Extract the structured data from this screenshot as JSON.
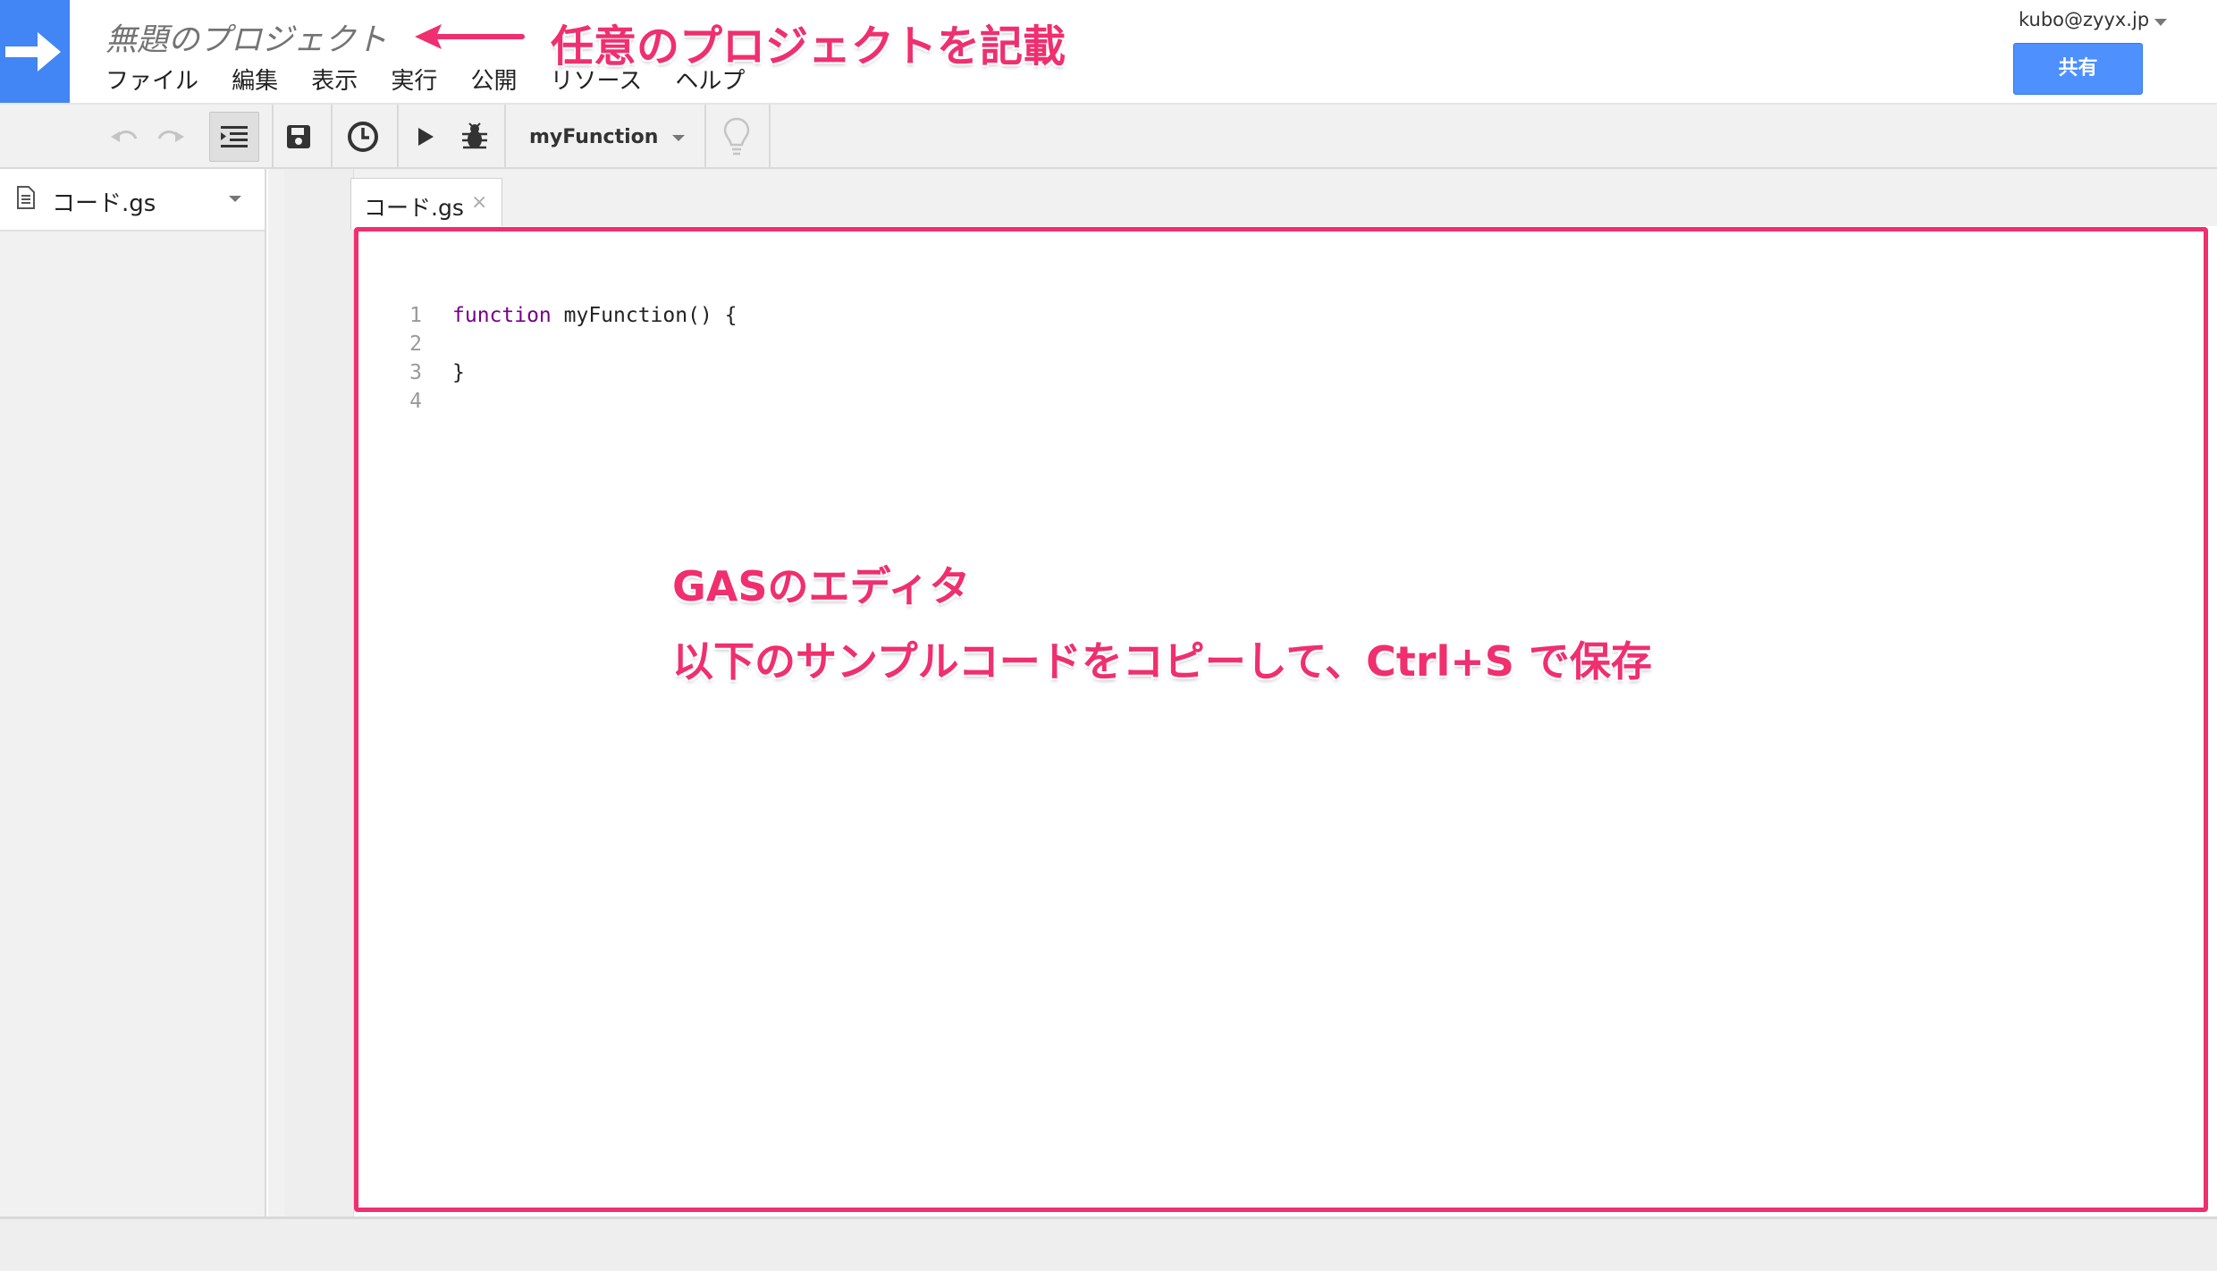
{
  "app": {
    "project_title": "無題のプロジェクト",
    "menu": [
      "ファイル",
      "編集",
      "表示",
      "実行",
      "公開",
      "リソース",
      "ヘルプ"
    ],
    "user_email": "kubo@zyyx.jp",
    "share_label": "共有"
  },
  "toolbar": {
    "undo_icon": "undo-icon",
    "redo_icon": "redo-icon",
    "indent_icon": "indent-icon",
    "save_icon": "save-icon",
    "triggers_icon": "clock-icon",
    "run_icon": "play-icon",
    "debug_icon": "bug-icon",
    "function_select": "myFunction",
    "hint_icon": "lightbulb-icon"
  },
  "sidebar": {
    "files": [
      {
        "name": "コード.gs",
        "icon": "document-icon"
      }
    ]
  },
  "editor": {
    "active_tab": "コード.gs",
    "tab_close": "×",
    "line_numbers": [
      "1",
      "2",
      "3",
      "4"
    ],
    "code_line_1_keyword": "function",
    "code_line_1_rest": " myFunction() {",
    "code_line_3": "}"
  },
  "annotations": {
    "title_note": "任意のプロジェクトを記載",
    "editor_note_line1": "GASのエディタ",
    "editor_note_line2": "以下のサンプルコードをコピーして、Ctrl+S で保存"
  },
  "colors": {
    "accent_blue": "#4285f4",
    "annotation_pink": "#ef2f6e",
    "keyword_purple": "#770088"
  }
}
